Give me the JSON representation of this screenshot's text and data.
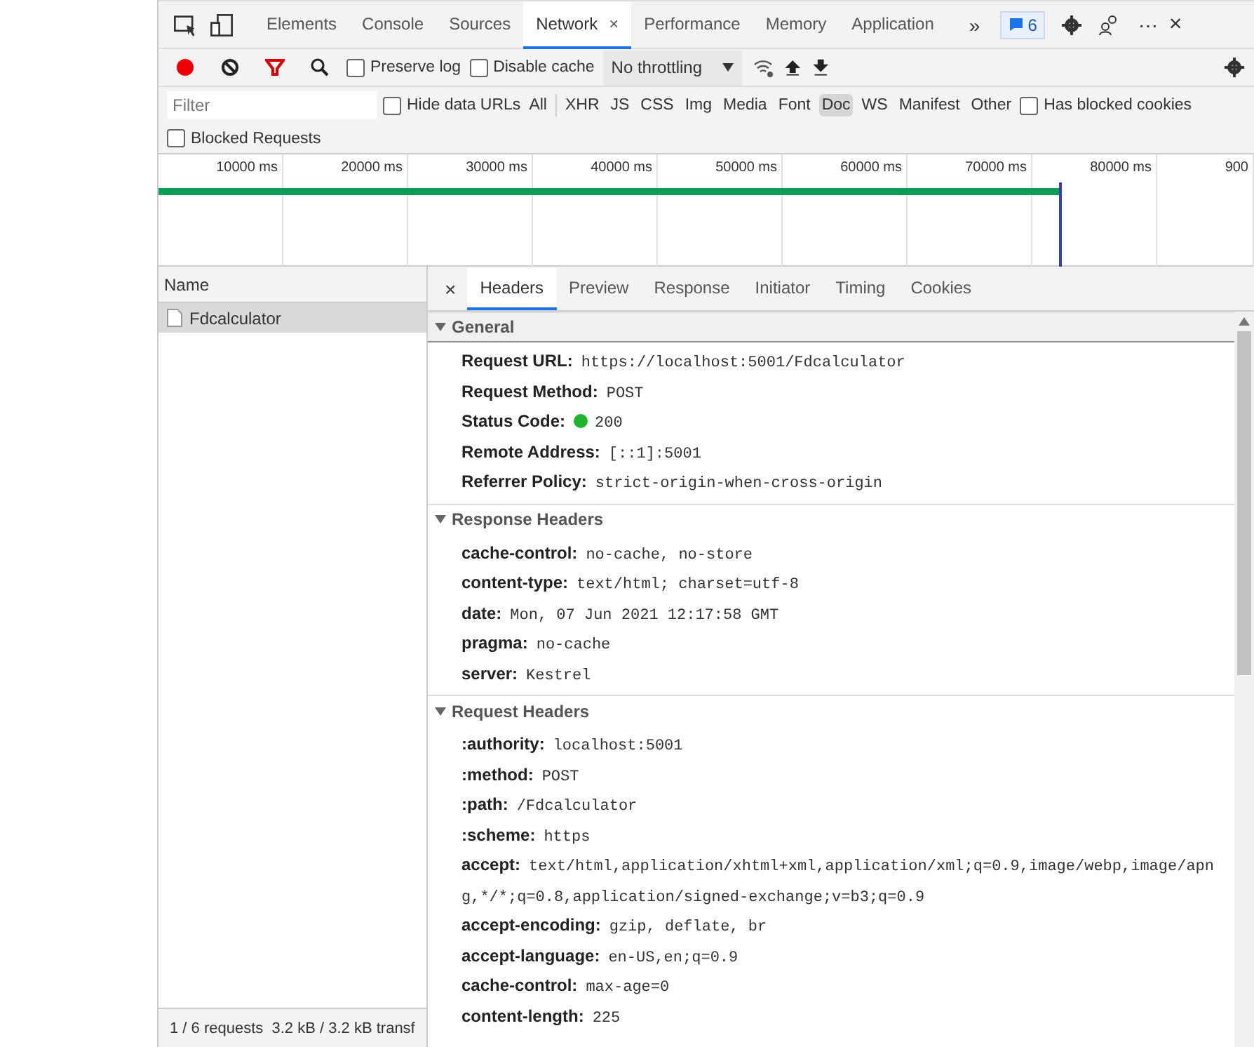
{
  "main_tabs": [
    {
      "label": "Elements",
      "selected": false
    },
    {
      "label": "Console",
      "selected": false
    },
    {
      "label": "Sources",
      "selected": false
    },
    {
      "label": "Network",
      "selected": true,
      "close": "×"
    },
    {
      "label": "Performance",
      "selected": false
    },
    {
      "label": "Memory",
      "selected": false
    },
    {
      "label": "Application",
      "selected": false
    }
  ],
  "more_tabs": "»",
  "issues_count": "6",
  "more_menu": "⋯",
  "close": "×",
  "toolbar": {
    "recording": true,
    "preserve_log": {
      "label": "Preserve log",
      "checked": false
    },
    "disable_cache": {
      "label": "Disable cache",
      "checked": false
    },
    "throttling": "No throttling"
  },
  "filter": {
    "placeholder": "Filter",
    "hide_data_urls": {
      "label": "Hide data URLs",
      "checked": false
    },
    "types": [
      {
        "label": "All",
        "selected": false
      },
      {
        "label": "XHR",
        "selected": false
      },
      {
        "label": "JS",
        "selected": false
      },
      {
        "label": "CSS",
        "selected": false
      },
      {
        "label": "Img",
        "selected": false
      },
      {
        "label": "Media",
        "selected": false
      },
      {
        "label": "Font",
        "selected": false
      },
      {
        "label": "Doc",
        "selected": true
      },
      {
        "label": "WS",
        "selected": false
      },
      {
        "label": "Manifest",
        "selected": false
      },
      {
        "label": "Other",
        "selected": false
      }
    ],
    "has_blocked_cookies": {
      "label": "Has blocked cookies",
      "checked": false
    },
    "blocked_requests": {
      "label": "Blocked Requests",
      "checked": false
    }
  },
  "timeline": {
    "ticks": [
      "10000 ms",
      "20000 ms",
      "30000 ms",
      "40000 ms",
      "50000 ms",
      "60000 ms",
      "70000 ms",
      "80000 ms",
      "900"
    ]
  },
  "requests": {
    "column": "Name",
    "rows": [
      {
        "name": "Fdcalculator",
        "selected": true
      }
    ],
    "status": "1 / 6 requests  3.2 kB / 3.2 kB transf"
  },
  "details": {
    "close": "×",
    "tabs": [
      {
        "label": "Headers",
        "selected": true
      },
      {
        "label": "Preview",
        "selected": false
      },
      {
        "label": "Response",
        "selected": false
      },
      {
        "label": "Initiator",
        "selected": false
      },
      {
        "label": "Timing",
        "selected": false
      },
      {
        "label": "Cookies",
        "selected": false
      }
    ],
    "sections": [
      {
        "title": "General",
        "expanded": true,
        "rows": [
          {
            "key": "Request URL:",
            "value": "https://localhost:5001/Fdcalculator"
          },
          {
            "key": "Request Method:",
            "value": "POST"
          },
          {
            "key": "Status Code:",
            "value": "200",
            "kind": "status"
          },
          {
            "key": "Remote Address:",
            "value": "[::1]:5001"
          },
          {
            "key": "Referrer Policy:",
            "value": "strict-origin-when-cross-origin"
          }
        ]
      },
      {
        "title": "Response Headers",
        "expanded": true,
        "rows": [
          {
            "key": "cache-control:",
            "value": "no-cache, no-store"
          },
          {
            "key": "content-type:",
            "value": "text/html; charset=utf-8"
          },
          {
            "key": "date:",
            "value": "Mon, 07 Jun 2021 12:17:58 GMT"
          },
          {
            "key": "pragma:",
            "value": "no-cache"
          },
          {
            "key": "server:",
            "value": "Kestrel"
          }
        ]
      },
      {
        "title": "Request Headers",
        "expanded": true,
        "rows": [
          {
            "key": ":authority:",
            "value": "localhost:5001"
          },
          {
            "key": ":method:",
            "value": "POST"
          },
          {
            "key": ":path:",
            "value": "/Fdcalculator"
          },
          {
            "key": ":scheme:",
            "value": "https"
          },
          {
            "key": "accept:",
            "value": "text/html,application/xhtml+xml,application/xml;q=0.9,image/webp,image/apng,*/*;q=0.8,application/signed-exchange;v=b3;q=0.9"
          },
          {
            "key": "accept-encoding:",
            "value": "gzip, deflate, br"
          },
          {
            "key": "accept-language:",
            "value": "en-US,en;q=0.9"
          },
          {
            "key": "cache-control:",
            "value": "max-age=0"
          },
          {
            "key": "content-length:",
            "value": "225"
          }
        ]
      }
    ]
  }
}
